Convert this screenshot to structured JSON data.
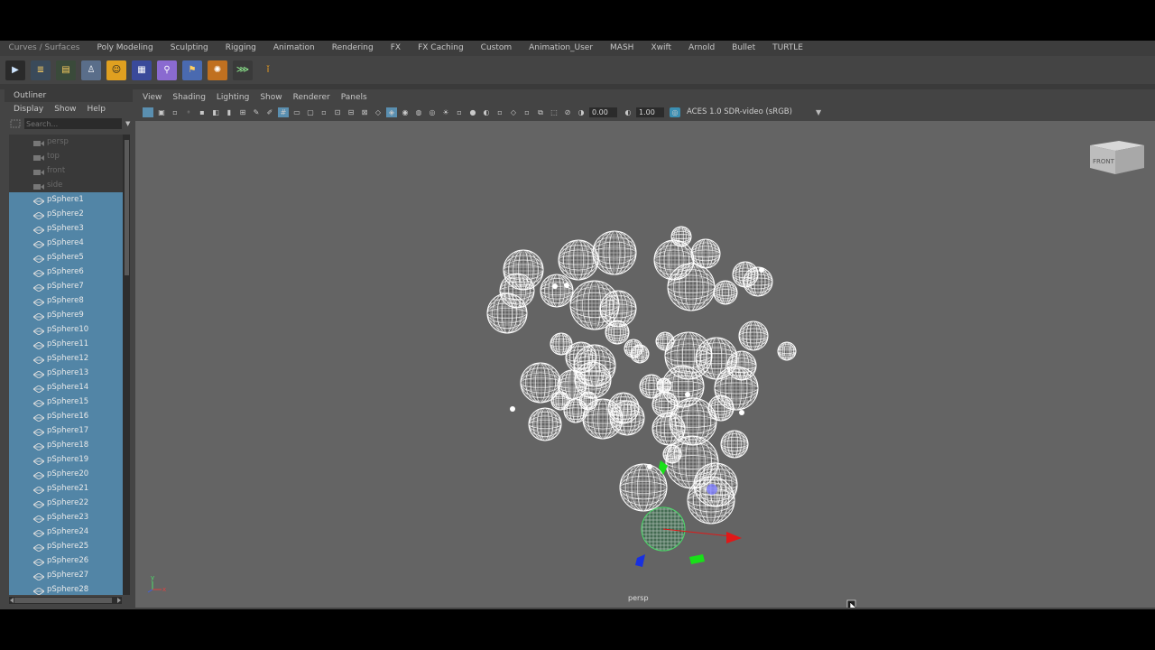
{
  "shelf": {
    "tabs": [
      "Curves / Surfaces",
      "Poly Modeling",
      "Sculpting",
      "Rigging",
      "Animation",
      "Rendering",
      "FX",
      "FX Caching",
      "Custom",
      "Animation_User",
      "MASH",
      "Xwift",
      "Arnold",
      "Bullet",
      "TURTLE"
    ],
    "icons": [
      "render-view-icon",
      "render-settings-icon",
      "hypershade-icon",
      "attribute-icon",
      "character-icon",
      "layer-manager-icon",
      "link-icon",
      "image-icon",
      "gear-sun-icon",
      "script-icon",
      "info-icon"
    ]
  },
  "outliner": {
    "title": "Outliner",
    "menu": [
      "Display",
      "Show",
      "Help"
    ],
    "search_placeholder": "Search...",
    "cameras": [
      "persp",
      "top",
      "front",
      "side"
    ],
    "items": [
      "pSphere1",
      "pSphere2",
      "pSphere3",
      "pSphere4",
      "pSphere5",
      "pSphere6",
      "pSphere7",
      "pSphere8",
      "pSphere9",
      "pSphere10",
      "pSphere11",
      "pSphere12",
      "pSphere13",
      "pSphere14",
      "pSphere15",
      "pSphere16",
      "pSphere17",
      "pSphere18",
      "pSphere19",
      "pSphere20",
      "pSphere21",
      "pSphere22",
      "pSphere23",
      "pSphere24",
      "pSphere25",
      "pSphere26",
      "pSphere27",
      "pSphere28"
    ]
  },
  "viewport": {
    "menu": [
      "View",
      "Shading",
      "Lighting",
      "Show",
      "Renderer",
      "Panels"
    ],
    "exposure": "0.00",
    "gamma": "1.00",
    "color_management": "ACES 1.0 SDR-video (sRGB)",
    "view_cube_label": "FRONT",
    "camera_label": "persp",
    "axis_y": "y",
    "axis_x": "x"
  },
  "colors": {
    "selection": "#5285a6",
    "viewport_bg": "#646464",
    "wire": "#ffffff",
    "manip_x": "#e01818",
    "manip_y": "#18e018",
    "manip_z": "#1830e0"
  }
}
